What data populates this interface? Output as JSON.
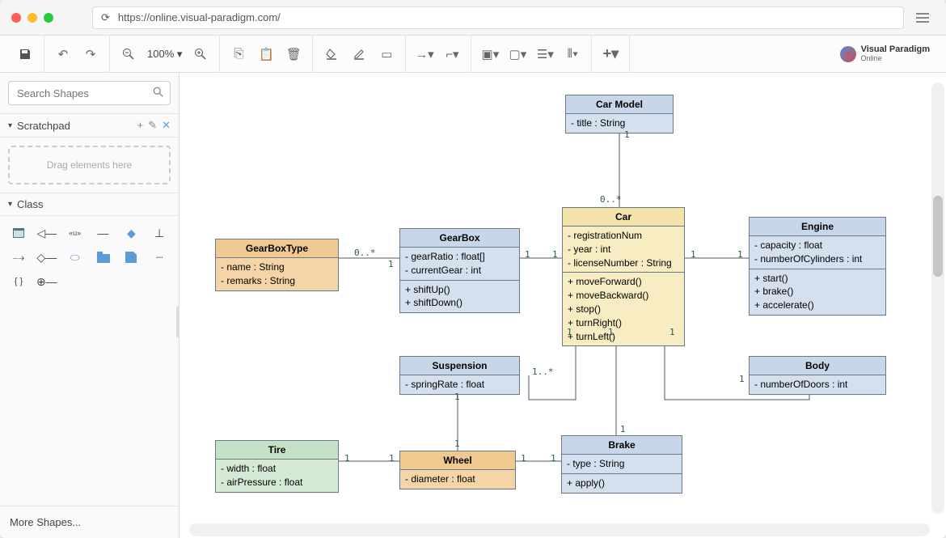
{
  "browser": {
    "url": "https://online.visual-paradigm.com/"
  },
  "toolbar": {
    "zoom": "100%"
  },
  "logo": {
    "line1": "Visual Paradigm",
    "line2": "Online"
  },
  "sidebar": {
    "search_placeholder": "Search Shapes",
    "scratchpad_label": "Scratchpad",
    "drop_hint": "Drag elements here",
    "class_label": "Class",
    "more_shapes": "More Shapes..."
  },
  "classes": {
    "carModel": {
      "name": "Car Model",
      "attrs": [
        "- title : String"
      ]
    },
    "gearBoxType": {
      "name": "GearBoxType",
      "attrs": [
        "- name : String",
        "- remarks : String"
      ]
    },
    "gearBox": {
      "name": "GearBox",
      "attrs": [
        "- gearRatio : float[]",
        "- currentGear : int"
      ],
      "ops": [
        "+ shiftUp()",
        "+ shiftDown()"
      ]
    },
    "car": {
      "name": "Car",
      "attrs": [
        "- registrationNum",
        "- year : int",
        "- licenseNumber : String"
      ],
      "ops": [
        "+ moveForward()",
        "+ moveBackward()",
        "+ stop()",
        "+ turnRight()",
        "+ turnLeft()"
      ]
    },
    "engine": {
      "name": "Engine",
      "attrs": [
        "- capacity : float",
        "- numberOfCylinders : int"
      ],
      "ops": [
        "+ start()",
        "+ brake()",
        "+ accelerate()"
      ]
    },
    "suspension": {
      "name": "Suspension",
      "attrs": [
        "- springRate : float"
      ]
    },
    "body": {
      "name": "Body",
      "attrs": [
        "- numberOfDoors : int"
      ]
    },
    "wheel": {
      "name": "Wheel",
      "attrs": [
        "- diameter : float"
      ]
    },
    "tire": {
      "name": "Tire",
      "attrs": [
        "- width : float",
        "- airPressure : float"
      ]
    },
    "brake": {
      "name": "Brake",
      "attrs": [
        "- type : String"
      ],
      "ops": [
        "+ apply()"
      ]
    }
  },
  "multiplicities": {
    "m1": "1",
    "m2": "0..*",
    "m3": "1..*"
  }
}
